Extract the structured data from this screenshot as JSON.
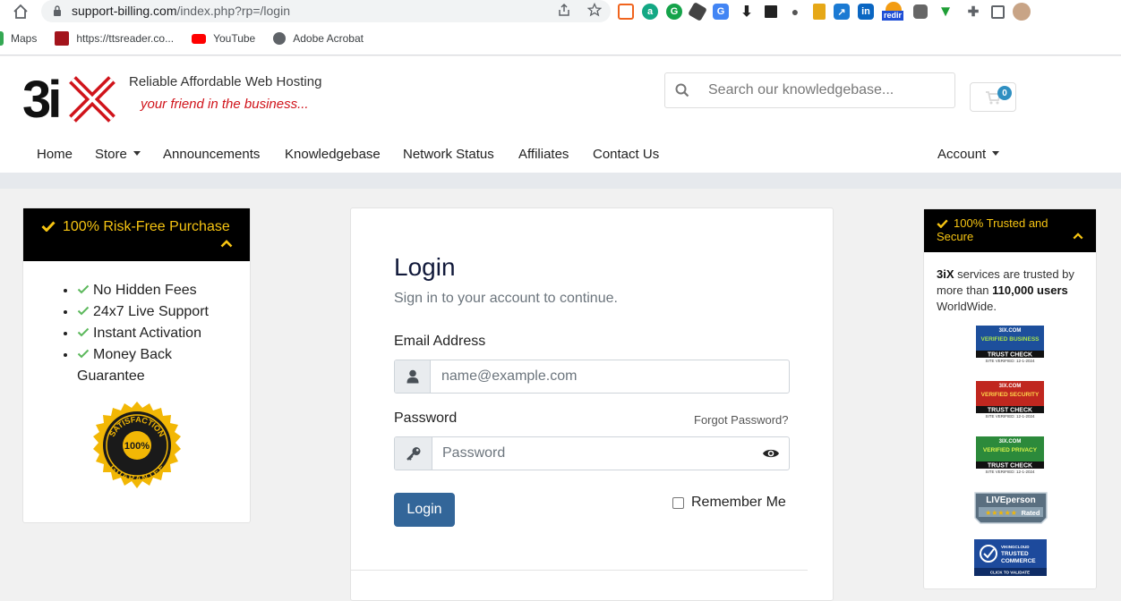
{
  "browser": {
    "url_host": "support-billing.com",
    "url_path": "/index.php?rp=/login",
    "bookmarks": [
      {
        "label": "Maps"
      },
      {
        "label": "https://ttsreader.co..."
      },
      {
        "label": "YouTube"
      },
      {
        "label": "Adobe Acrobat"
      }
    ],
    "ext_redir_label": "redir"
  },
  "header": {
    "logo_text": "3iX",
    "tagline": "Reliable Affordable Web Hosting",
    "tagline_sub": "your friend in the business...",
    "search_placeholder": "Search our knowledgebase...",
    "cart_count": "0"
  },
  "nav": {
    "items": [
      {
        "label": "Home"
      },
      {
        "label": "Store"
      },
      {
        "label": "Announcements"
      },
      {
        "label": "Knowledgebase"
      },
      {
        "label": "Network Status"
      },
      {
        "label": "Affiliates"
      },
      {
        "label": "Contact Us"
      }
    ],
    "account": "Account"
  },
  "promo": {
    "title": "100% Risk-Free Purchase",
    "items": [
      "No Hidden Fees",
      "24x7 Live Support",
      "Instant Activation",
      "Money Back Guarantee"
    ],
    "seal_top": "SATISFACTION",
    "seal_mid": "100%",
    "seal_bottom": "GUARANTEE"
  },
  "login": {
    "title": "Login",
    "subtitle": "Sign in to your account to continue.",
    "email_label": "Email Address",
    "email_placeholder": "name@example.com",
    "password_label": "Password",
    "forgot": "Forgot Password?",
    "password_placeholder": "Password",
    "button": "Login",
    "remember": "Remember Me"
  },
  "trust": {
    "title": "100% Trusted and Secure",
    "text_brand": "3iX",
    "text_1": " services are trusted by more than ",
    "text_bold": "110,000 users",
    "text_2": " WorldWide.",
    "badges": [
      {
        "top": "3IX.COM",
        "kind": "VERIFIED BUSINESS",
        "name": "TRUST CHECK",
        "date": "SITE VERIFIED: 12-1-2024",
        "color": "#1d4f9c"
      },
      {
        "top": "3IX.COM",
        "kind": "VERIFIED SECURITY",
        "name": "TRUST CHECK",
        "date": "SITE VERIFIED: 12-1-2024",
        "color": "#c0271f"
      },
      {
        "top": "3IX.COM",
        "kind": "VERIFIED PRIVACY",
        "name": "TRUST CHECK",
        "date": "SITE VERIFIED: 12-1-2024",
        "color": "#2c8a3b"
      }
    ],
    "liveperson": "LIVEperson",
    "liveperson_rated": "Rated",
    "viking_1": "VIKINGCLOUD",
    "viking_2": "TRUSTED",
    "viking_3": "COMMERCE",
    "viking_4": "CLICK TO VALIDATE"
  }
}
